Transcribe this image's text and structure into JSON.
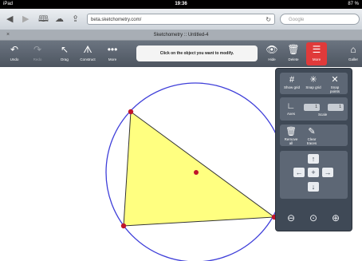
{
  "status": {
    "device": "iPad",
    "time": "19:36",
    "battery": "87 %"
  },
  "browser": {
    "url": "beta.sketchometry.com/",
    "search_placeholder": "Google",
    "reload_icon": "reload-icon"
  },
  "tab": {
    "close": "×",
    "title": "Sketchometry :: Untitled-4"
  },
  "toolbar": {
    "undo": "Undo",
    "redo": "Redo",
    "drag": "Drag",
    "construct": "Construct",
    "more": "More",
    "hint": "Click on the object you want to modify.",
    "hide": "Hide",
    "delete": "Delete",
    "menu_active": "More",
    "gallery": "Galler"
  },
  "panel": {
    "show_grid": "Show grid",
    "snap_grid": "Snap grid",
    "snap_points": "Snap points",
    "axes": "Axes",
    "scale_x": "1",
    "scale_y": "1",
    "scale_label": "Scale",
    "remove_all": "Remove all",
    "clear_traces": "Clear traces"
  },
  "colors": {
    "triangle_fill": "#ffff80",
    "circle_stroke": "#3f3fd9",
    "point": "#c0142b",
    "active": "#e03a3a"
  }
}
